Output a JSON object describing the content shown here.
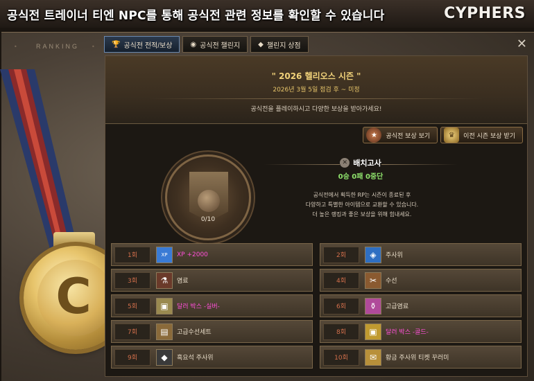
{
  "banner": {
    "text": "공식전 트레이너 티엔 NPC를 통해 공식전 관련 정보를 확인할 수 있습니다",
    "logo": "CYPHERS"
  },
  "window": {
    "ranking_label": "RANKING",
    "close_icon": "close-icon"
  },
  "tabs": [
    {
      "label": "공식전 전적/보상",
      "icon": "trophy-icon",
      "active": true
    },
    {
      "label": "공식전 챌린지",
      "icon": "coin-icon",
      "active": false
    },
    {
      "label": "챌린지 상점",
      "icon": "gem-icon",
      "active": false
    }
  ],
  "season": {
    "title": "\" 2026 헬리오스 시즌 \"",
    "date": "2026년 3월 5일 점검 후 ~ 미정",
    "description": "공식전을 플레이하시고 다양한 보상을 받아가세요!"
  },
  "buttons": {
    "view_rewards": "공식전 보상 보기",
    "prev_season_rewards": "이전 시즌 보상 받기"
  },
  "rank": {
    "progress_text": "0/10",
    "progress_fraction": 0.0
  },
  "placement": {
    "title": "배치고사",
    "record": "0승 0패 0중단"
  },
  "description_lines": [
    "공식전에서 획득한 RP는 시즌이 종료된 후",
    "다양하고 특별한 아이템으로 교환할 수 있습니다.",
    "더 높은 랭킹과 좋은 보상을 위해 힘내세요."
  ],
  "rewards": [
    {
      "num": "1회",
      "label": "XP +2000",
      "icon": "xp-icon",
      "pink": true,
      "color": "#3a7bd5"
    },
    {
      "num": "2회",
      "label": "주사위",
      "icon": "dice-icon",
      "pink": false,
      "color": "#2f6fc2"
    },
    {
      "num": "3회",
      "label": "염료",
      "icon": "dye-icon",
      "pink": false,
      "color": "#6a3a2a"
    },
    {
      "num": "4회",
      "label": "수선",
      "icon": "repair-icon",
      "pink": false,
      "color": "#8a5a30"
    },
    {
      "num": "5회",
      "label": "달러 박스 -실버-",
      "icon": "silver-box-icon",
      "pink": true,
      "color": "#9a8a50"
    },
    {
      "num": "6회",
      "label": "고급염료",
      "icon": "premium-dye-icon",
      "pink": false,
      "color": "#b04a9a"
    },
    {
      "num": "7회",
      "label": "고급수선세트",
      "icon": "repair-set-icon",
      "pink": false,
      "color": "#8a6a3a"
    },
    {
      "num": "8회",
      "label": "달러 박스 -골드-",
      "icon": "gold-box-icon",
      "pink": true,
      "color": "#c09a30"
    },
    {
      "num": "9회",
      "label": "흑요석 주사위",
      "icon": "obsidian-dice-icon",
      "pink": false,
      "color": "#3a3a3a"
    },
    {
      "num": "10회",
      "label": "황금 주사위 티켓 꾸러미",
      "icon": "gold-ticket-icon",
      "pink": false,
      "color": "#b8903a"
    }
  ]
}
